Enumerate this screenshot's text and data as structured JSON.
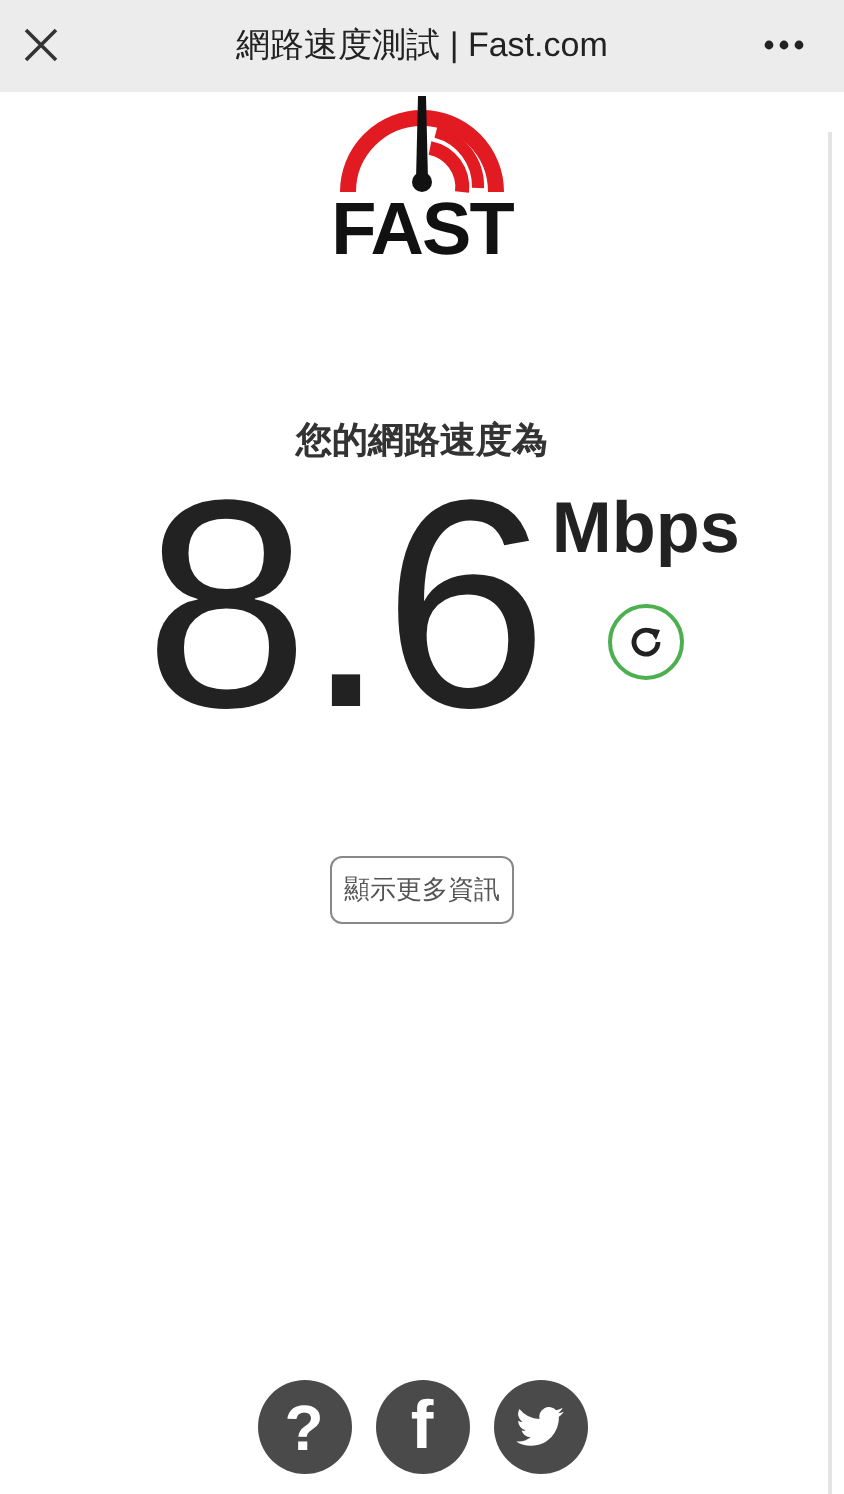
{
  "header": {
    "title": "網路速度測試 | Fast.com"
  },
  "logo": {
    "text": "FAST"
  },
  "speed": {
    "caption": "您的網路速度為",
    "value": "8.6",
    "unit": "Mbps"
  },
  "more_info_button": {
    "label": "顯示更多資訊"
  },
  "footer_icons": [
    {
      "kind": "help",
      "glyph": "?"
    },
    {
      "kind": "facebook",
      "glyph": "f"
    },
    {
      "kind": "twitter"
    }
  ]
}
